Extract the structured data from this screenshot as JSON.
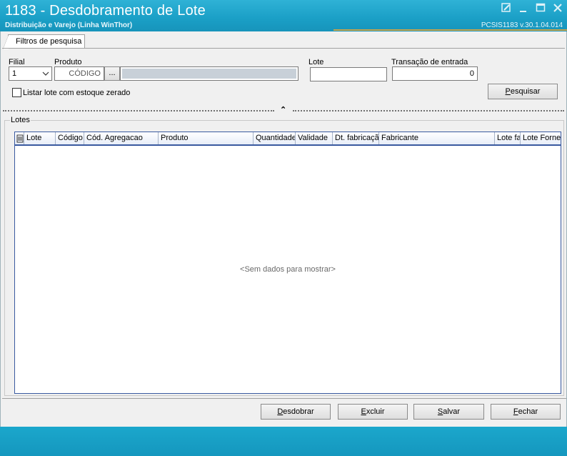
{
  "window": {
    "title": "1183 - Desdobramento de Lote",
    "subtitle": "Distribuição e Varejo (Linha WinThor)",
    "version": "PCSIS1183  v.30.1.04.014"
  },
  "tabs": [
    {
      "label": "Filtros de pesquisa"
    }
  ],
  "filters": {
    "filial_label": "Filial",
    "filial_value": "1",
    "produto_label": "Produto",
    "produto_code_placeholder": "CÓDIGO",
    "produto_browse": "...",
    "produto_desc": "",
    "lote_label": "Lote",
    "lote_value": "",
    "transacao_label": "Transação de entrada",
    "transacao_value": "0",
    "checkbox_label": "Listar lote com estoque zerado",
    "checkbox_checked": false,
    "search_button": {
      "label": "Pesquisar",
      "hotkey": "P",
      "rest": "esquisar"
    }
  },
  "lotes": {
    "group_title": "Lotes",
    "columns": [
      "Lote",
      "Código",
      "Cód. Agregacao",
      "Produto",
      "Quantidade",
      "Validade",
      "Dt. fabricação",
      "Fabricante",
      "Lote fa",
      "Lote Forne"
    ],
    "rows": [],
    "empty_message": "<Sem dados para mostrar>"
  },
  "actions": {
    "desdobrar": {
      "hotkey": "D",
      "rest": "esdobrar"
    },
    "excluir": {
      "hotkey": "E",
      "rest": "xcluir"
    },
    "salvar": {
      "hotkey": "S",
      "rest": "alvar"
    },
    "fechar": {
      "hotkey": "F",
      "rest": "echar"
    }
  },
  "colors": {
    "title_bg": "#1a9fc6",
    "accent_line": "#c9a449",
    "grid_border": "#3a5aa0"
  }
}
